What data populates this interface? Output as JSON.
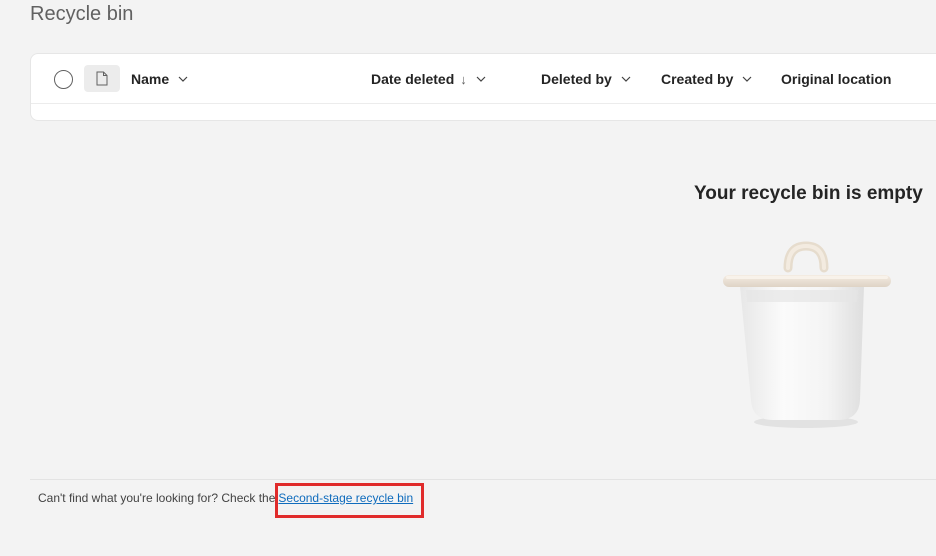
{
  "page": {
    "title": "Recycle bin"
  },
  "list": {
    "columns": {
      "name": "Name",
      "date_deleted": "Date deleted",
      "date_sort_arrow": "↓",
      "deleted_by": "Deleted by",
      "created_by": "Created by",
      "original_location": "Original location"
    },
    "icons": {
      "select_all": "circle-checkbox-icon",
      "file_type": "document-icon",
      "sort_dropdown": "chevron-down-icon"
    }
  },
  "empty_state": {
    "message": "Your recycle bin is empty",
    "illustration": "trash-bin-illustration"
  },
  "footer": {
    "prompt": "Can't find what you're looking for? Check the",
    "link_text": "Second-stage recycle bin"
  },
  "annotation": {
    "highlight_color": "#e02b2b"
  }
}
